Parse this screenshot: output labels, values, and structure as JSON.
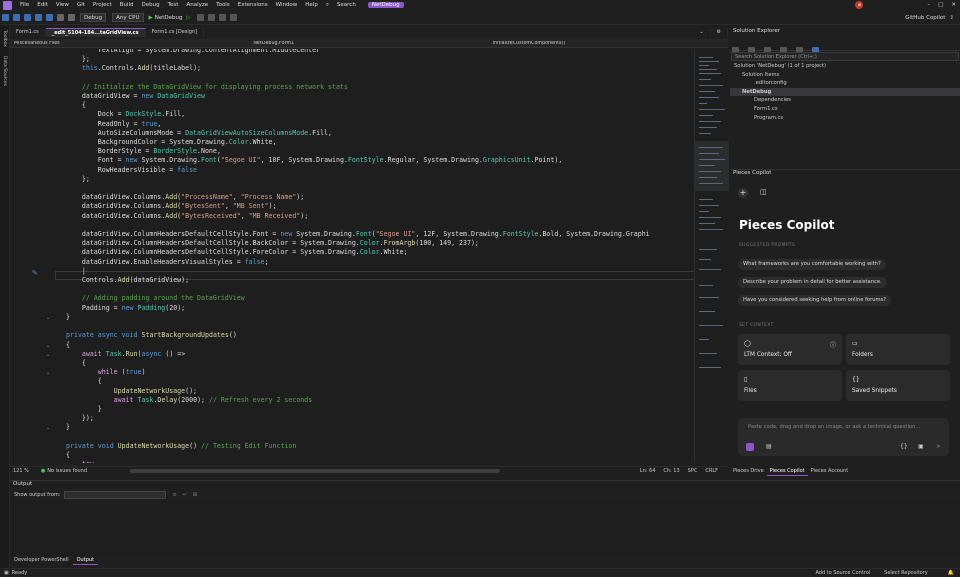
{
  "menu": {
    "items": [
      "File",
      "Edit",
      "View",
      "Git",
      "Project",
      "Build",
      "Debug",
      "Test",
      "Analyze",
      "Tools",
      "Extensions",
      "Window",
      "Help"
    ],
    "search": "Search",
    "solution_pill": "NetDebug",
    "badge": "JB",
    "copilot": "GitHub Copilot"
  },
  "toolbar": {
    "config": "Debug",
    "platform": "Any CPU",
    "run": "NetDebug"
  },
  "left_strip": {
    "toolbox": "Toolbox",
    "data_sources": "Data Sources"
  },
  "tabs": [
    {
      "label": "Form1.cs"
    },
    {
      "label": "_edit_5104-184...taGridView.cs"
    },
    {
      "label": "Form1.cs [Design]"
    }
  ],
  "nav": {
    "project": "Miscellaneous Files",
    "class": "NetDebug.Form1",
    "member": "InitializeCustomComponents()"
  },
  "editor_status": {
    "zoom": "121 %",
    "issues": "No issues found",
    "ln": "Ln: 64",
    "ch": "Ch: 13",
    "enc": "SPC",
    "eol": "CRLF"
  },
  "output": {
    "title": "Output",
    "show_from": "Show output from:"
  },
  "bottom_tabs": [
    "Developer PowerShell",
    "Output"
  ],
  "status": {
    "ready": "Ready",
    "add_source": "Add to Source Control",
    "select_repo": "Select Repository"
  },
  "solution_explorer": {
    "title": "Solution Explorer",
    "search": "Search Solution Explorer (Ctrl+;)",
    "tree": [
      "Solution 'NetDebug' (1 of 1 project)",
      "Solution Items",
      ".editorconfig",
      "NetDebug",
      "Dependencies",
      "Form1.cs",
      "Program.cs"
    ]
  },
  "pieces": {
    "panel_title": "Pieces Copilot",
    "title": "Pieces Copilot",
    "suggested": "SUGGESTED PROMPTS",
    "prompts": [
      "What frameworks are you comfortable working with?",
      "Describe your problem in detail for better assistance.",
      "Have you considered seeking help from online forums?"
    ],
    "set_context": "SET CONTEXT",
    "cards": [
      "LTM Context: Off",
      "Folders",
      "Files",
      "Saved Snippets"
    ],
    "input_placeholder": "Paste code, drag and drop an image, or ask a technical question...",
    "tabs": [
      "Pieces Drive",
      "Pieces Copilot",
      "Pieces Account"
    ]
  }
}
